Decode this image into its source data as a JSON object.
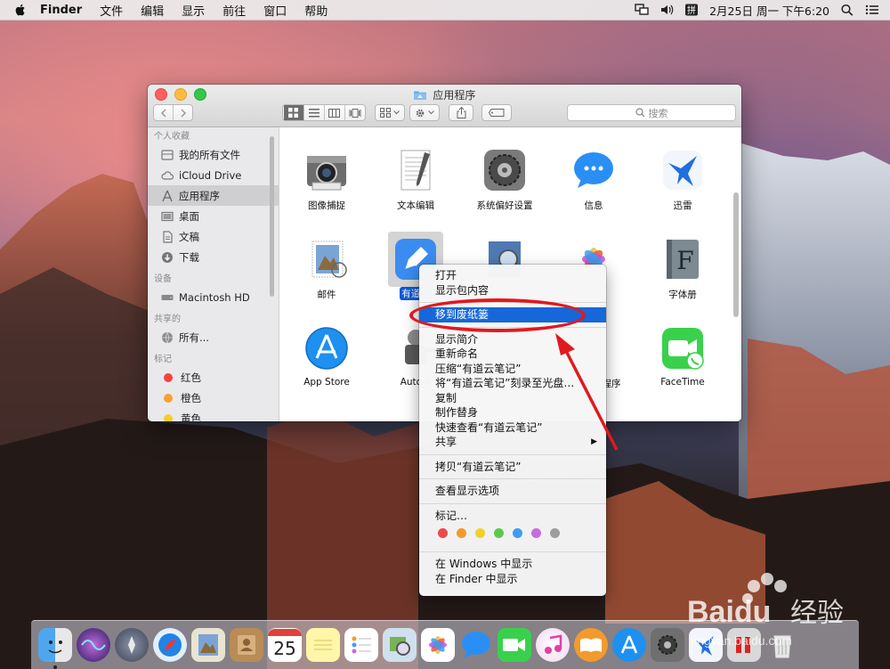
{
  "menubar": {
    "app_name": "Finder",
    "items": [
      "文件",
      "编辑",
      "显示",
      "前往",
      "窗口",
      "帮助"
    ],
    "clock": "2月25日 周一 下午6:20"
  },
  "window": {
    "title": "应用程序",
    "search_placeholder": "搜索",
    "sidebar": {
      "favorites_header": "个人收藏",
      "favorites": [
        "我的所有文件",
        "iCloud Drive",
        "应用程序",
        "桌面",
        "文稿",
        "下载"
      ],
      "devices_header": "设备",
      "devices": [
        "Macintosh HD"
      ],
      "shared_header": "共享的",
      "shared": [
        "所有..."
      ],
      "tags_header": "标记",
      "tags": [
        {
          "label": "红色",
          "color": "#f2443a"
        },
        {
          "label": "橙色",
          "color": "#f7a130"
        },
        {
          "label": "黄色",
          "color": "#f4cf2b"
        }
      ]
    },
    "apps": [
      {
        "label": "图像捕捉"
      },
      {
        "label": "文本编辑"
      },
      {
        "label": "系统偏好设置"
      },
      {
        "label": "信息"
      },
      {
        "label": "迅雷"
      },
      {
        "label": "邮件"
      },
      {
        "label": "有道云"
      },
      {
        "label": "字体册"
      },
      {
        "label": "App Store"
      },
      {
        "label": "Autom"
      },
      {
        "label": "程序"
      },
      {
        "label": "FaceTime"
      }
    ]
  },
  "context_menu": {
    "group1": [
      "打开",
      "显示包内容"
    ],
    "trash": "移到废纸篓",
    "group2": [
      "显示简介",
      "重新命名",
      "压缩“有道云笔记”",
      "将“有道云笔记”刻录至光盘…",
      "复制",
      "制作替身",
      "快速查看“有道云笔记”",
      "共享"
    ],
    "copy": "拷贝“有道云笔记”",
    "view_options": "查看显示选项",
    "tags": "标记…",
    "tag_colors": [
      "#ef4a4a",
      "#f39a2e",
      "#f3cf2d",
      "#5cc94a",
      "#3c9ef0",
      "#c66be0",
      "#9d9d9d"
    ],
    "group3": [
      "在 Windows 中显示",
      "在 Finder 中显示"
    ]
  },
  "watermark": {
    "brand": "Baidu",
    "suffix": "经验",
    "url": "jingyan.baidu.com"
  },
  "dock": [
    "Finder",
    "Siri",
    "Launchpad",
    "Safari",
    "邮件",
    "通讯录",
    "日历",
    "备忘录",
    "提醒事项",
    "预览",
    "照片",
    "信息",
    "FaceTime",
    "iTunes",
    "iBooks",
    "App Store",
    "系统偏好设置",
    "迅雷",
    "Parallels",
    "废纸篓"
  ],
  "calendar_day": "25"
}
